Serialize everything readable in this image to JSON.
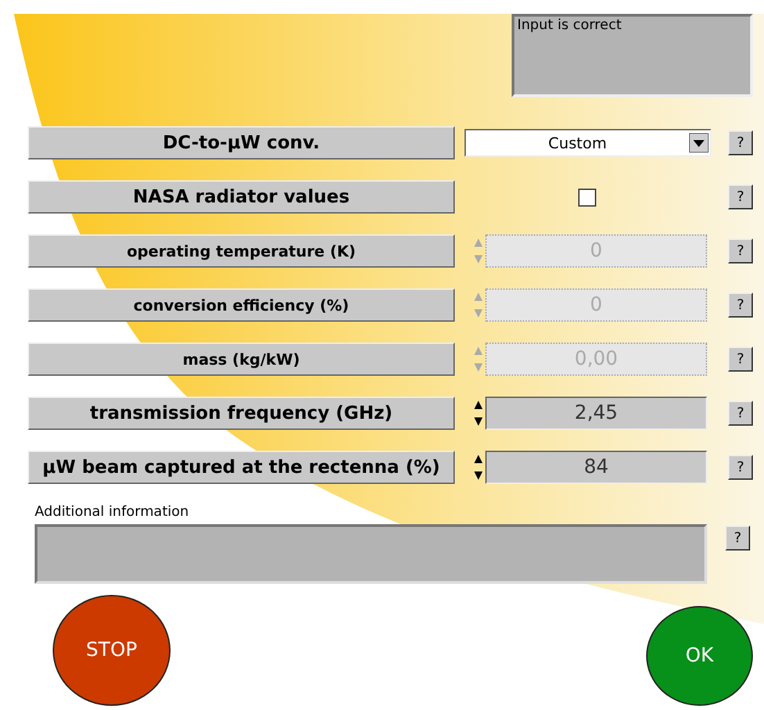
{
  "status_box": {
    "text": "Input is correct"
  },
  "rows": [
    {
      "kind": "dropdown",
      "label": "DC-to-µW conv.",
      "value": "Custom"
    },
    {
      "kind": "checkbox",
      "label": "NASA radiator values",
      "checked": false
    },
    {
      "kind": "number",
      "label": "operating temperature (K)",
      "value": "0",
      "disabled": true
    },
    {
      "kind": "number",
      "label": "conversion efficiency (%)",
      "value": "0",
      "disabled": true
    },
    {
      "kind": "number",
      "label": "mass (kg/kW)",
      "value": "0,00",
      "disabled": true
    },
    {
      "kind": "number",
      "label": "transmission frequency (GHz)",
      "value": "2,45",
      "disabled": false
    },
    {
      "kind": "number",
      "label": "µW beam captured at the rectenna (%)",
      "value": "84",
      "disabled": false
    }
  ],
  "help_button": "?",
  "additional_info": {
    "label": "Additional information",
    "help": "?"
  },
  "buttons": {
    "stop": "STOP",
    "ok": "OK"
  }
}
